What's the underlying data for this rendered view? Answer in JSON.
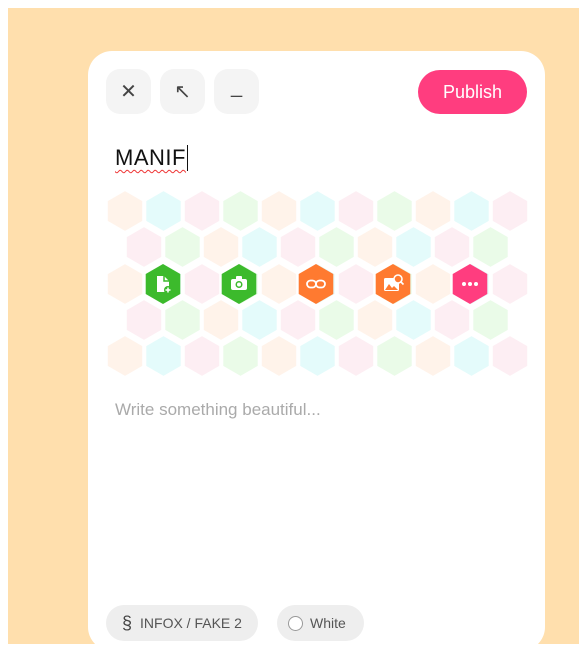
{
  "colors": {
    "backdrop": "#ffdfad",
    "accent": "#ff3d7f",
    "green": "#3cba2c",
    "orange": "#ff7a30"
  },
  "toolbar": {
    "close_icon": "close-icon",
    "expand_icon": "arrow-up-left-icon",
    "minimize_icon": "minimize-icon",
    "close_glyph": "✕",
    "expand_glyph": "↖",
    "minimize_glyph": "_",
    "publish_label": "Publish"
  },
  "post": {
    "title": "MANIF",
    "body_placeholder": "Write something beautiful..."
  },
  "actions": [
    {
      "icon": "add-document-icon",
      "color": "#3cba2c"
    },
    {
      "icon": "camera-icon",
      "color": "#3cba2c"
    },
    {
      "icon": "link-icon",
      "color": "#ff7a30"
    },
    {
      "icon": "image-search-icon",
      "color": "#ff7a30"
    },
    {
      "icon": "more-icon",
      "color": "#ff3d7f"
    }
  ],
  "footer": {
    "section_symbol": "§",
    "section_label": "INFOX / FAKE 2",
    "color_label": "White"
  }
}
